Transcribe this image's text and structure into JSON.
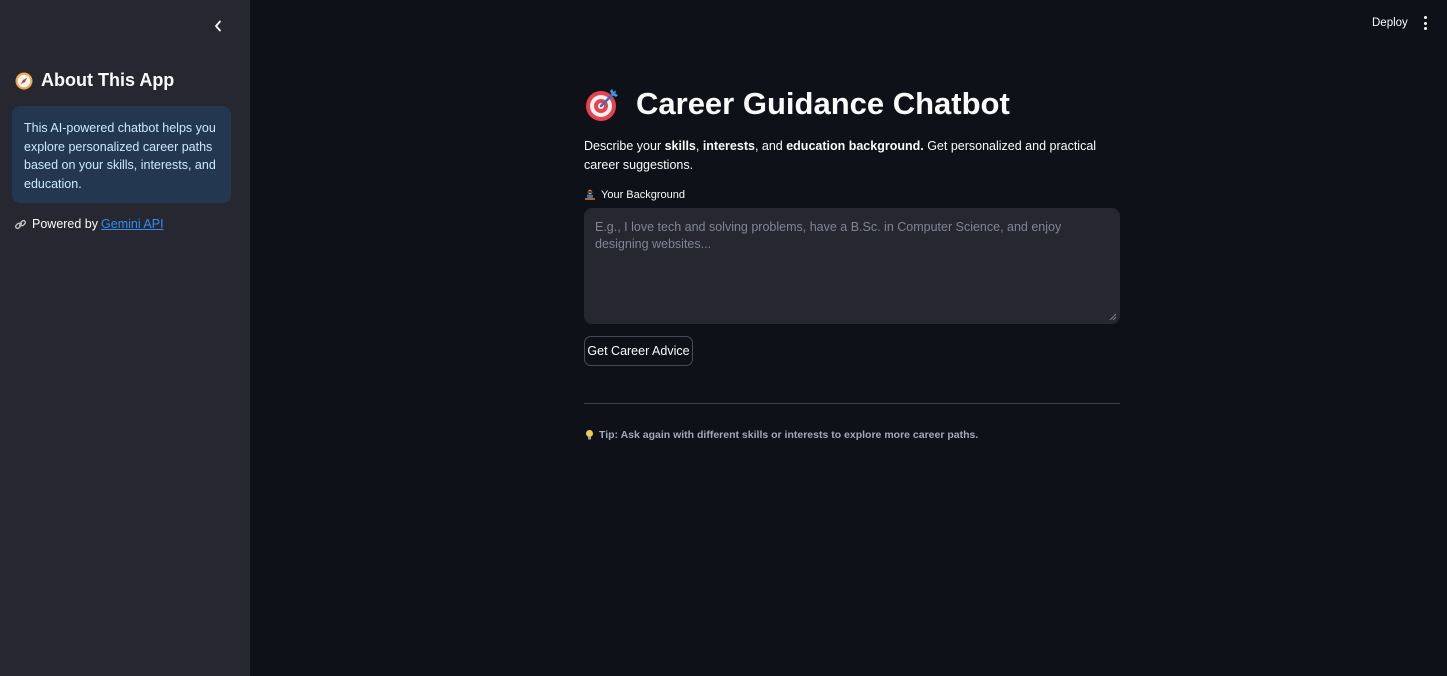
{
  "sidebar": {
    "collapse_icon": "chevron-left-icon",
    "title_icon": "compass-icon",
    "title": "About This App",
    "info_text": "This AI-powered chatbot helps you explore personalized career paths based on your skills, interests, and education.",
    "powered_icon": "link-icon",
    "powered_prefix": "Powered by ",
    "powered_link": "Gemini API"
  },
  "header": {
    "deploy_label": "Deploy",
    "menu_icon": "kebab-menu-icon"
  },
  "main": {
    "title_icon": "target-icon",
    "title": "Career Guidance Chatbot",
    "description": {
      "p1": "Describe your ",
      "b1": "skills",
      "p2": ", ",
      "b2": "interests",
      "p3": ", and ",
      "b3": "education background.",
      "p4": " Get personalized and practical career suggestions."
    },
    "input_label_icon": "person-at-desk-icon",
    "input_label": "Your Background",
    "input_value": "",
    "input_placeholder": "E.g., I love tech and solving problems, have a B.Sc. in Computer Science, and enjoy designing websites...",
    "submit_label": "Get Career Advice",
    "tip_icon": "lightbulb-icon",
    "tip": "Tip: Ask again with different skills or interests to explore more career paths."
  },
  "colors": {
    "background": "#0e1117",
    "sidebar": "#262730",
    "info_box_text": "#c7ebff",
    "link": "#2f8ff0"
  }
}
